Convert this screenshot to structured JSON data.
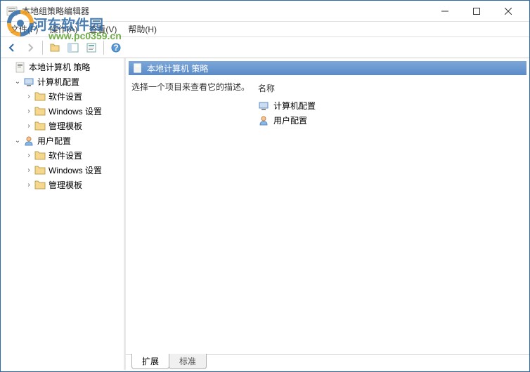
{
  "watermark": {
    "text_main": "河东软件园",
    "text_url": "www.pc0359.cn"
  },
  "titlebar": {
    "title": "本地组策略编辑器"
  },
  "menubar": {
    "file": "文件(F)",
    "action": "操作(A)",
    "view": "查看(V)",
    "help": "帮助(H)"
  },
  "tree": {
    "root": "本地计算机 策略",
    "computer": "计算机配置",
    "user": "用户配置",
    "software": "软件设置",
    "windows": "Windows 设置",
    "admin": "管理模板"
  },
  "main": {
    "header": "本地计算机 策略",
    "description": "选择一个项目来查看它的描述。",
    "column_name": "名称",
    "items": [
      {
        "label": "计算机配置",
        "icon": "computer"
      },
      {
        "label": "用户配置",
        "icon": "user"
      }
    ],
    "tabs": {
      "extended": "扩展",
      "standard": "标准"
    }
  }
}
